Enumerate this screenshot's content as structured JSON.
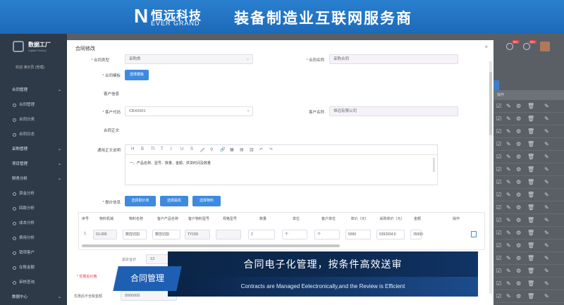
{
  "banner": {
    "logo_mark": "N",
    "logo_cn": "恒远科技",
    "logo_en": "EVER GRAND",
    "slogan": "装备制造业互联网服务商"
  },
  "sidebar": {
    "brand": "数据工厂",
    "brand_sub": "Digital Factory",
    "welcome": "欢迎 演示员 (管理)",
    "items": [
      {
        "label": "合同管理",
        "type": "group"
      },
      {
        "label": "合同管理",
        "type": "sub"
      },
      {
        "label": "合同分类",
        "type": "sub"
      },
      {
        "label": "合同日志",
        "type": "sub"
      },
      {
        "label": "采购管理",
        "type": "group"
      },
      {
        "label": "项目管理",
        "type": "group"
      },
      {
        "label": "财务分析",
        "type": "group"
      },
      {
        "label": "资金分析",
        "type": "sub"
      },
      {
        "label": "回款分析",
        "type": "sub"
      },
      {
        "label": "成本分析",
        "type": "sub"
      },
      {
        "label": "费用分析",
        "type": "sub"
      },
      {
        "label": "销项客户",
        "type": "sub"
      },
      {
        "label": "在账金额",
        "type": "sub"
      },
      {
        "label": "审核查询",
        "type": "sub"
      },
      {
        "label": "数据中心",
        "type": "group"
      }
    ]
  },
  "topbar": {
    "badge1": "99+",
    "badge2": "99+"
  },
  "right_table": {
    "header": "操作"
  },
  "modal": {
    "title": "合同修改",
    "close": "×",
    "labels": {
      "contract_type": "合同类型",
      "contract_name": "合同名称",
      "template": "合同模板",
      "customer_info": "客户信息",
      "customer_code": "客户代码",
      "customer_name": "客户名称",
      "contract_body": "合同正文",
      "general_text": "通用正文说明",
      "quote_info": "报价信息"
    },
    "values": {
      "contract_type": "采购类",
      "contract_name": "采购合同",
      "customer_code": "CBX0001",
      "customer_name": "恒远有限公司"
    },
    "buttons": {
      "select_template": "选择模板",
      "select_quote": "选择报价单",
      "select_machine": "选择属机",
      "select_material": "选择物料"
    },
    "editor_toolbar": [
      "H",
      "B",
      "TI",
      "T",
      "I",
      "U",
      "S",
      "🖉",
      "⚲",
      "🔗",
      "▦",
      "▤",
      "▥",
      "↶",
      "↷"
    ],
    "editor_content": "一、产品名称、型号、数量、金额、供货时间及数量",
    "table_headers": [
      "序号",
      "物料机械",
      "物料名称",
      "客户产品名称",
      "客户物料型号",
      "规格型号",
      "数量",
      "单位",
      "客户单位",
      "单价（元）",
      "采购单价（元）",
      "金额",
      "操作"
    ],
    "table_row": [
      "1",
      "01-000",
      "数控切割",
      "数控切割",
      "TY109",
      "",
      "2",
      "个",
      "个",
      "5000",
      "6392934.6",
      "35000"
    ],
    "bottom_rows": {
      "label1": "总价合计",
      "value1": "13",
      "label2": "优惠后价格",
      "label3": "优惠后不含税金额",
      "value3": "5000000"
    }
  },
  "overlay": {
    "main": "合同电子化管理，按条件高效送审",
    "sub": "Contracts are Managed Eelectronically,and the  Review is Efficient",
    "tag": "合同管理"
  }
}
